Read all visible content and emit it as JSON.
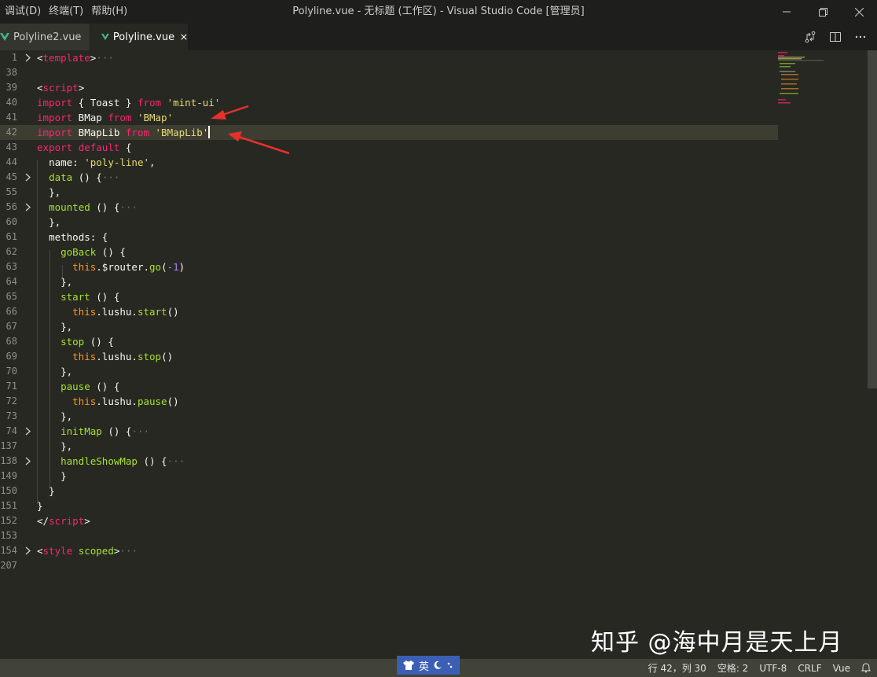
{
  "menu": [
    "调试(D)",
    "终端(T)",
    "帮助(H)"
  ],
  "window_title": "Polyline.vue - 无标题 (工作区) - Visual Studio Code [管理员]",
  "tabs": [
    {
      "label": "Polyline2.vue",
      "active": false
    },
    {
      "label": "Polyline.vue",
      "active": true
    }
  ],
  "lines": [
    {
      "n": "1",
      "fold": true
    },
    {
      "n": "38"
    },
    {
      "n": "39"
    },
    {
      "n": "40"
    },
    {
      "n": "41"
    },
    {
      "n": "42"
    },
    {
      "n": "43"
    },
    {
      "n": "44"
    },
    {
      "n": "45",
      "fold": true
    },
    {
      "n": "55"
    },
    {
      "n": "56",
      "fold": true
    },
    {
      "n": "60"
    },
    {
      "n": "61"
    },
    {
      "n": "62"
    },
    {
      "n": "63"
    },
    {
      "n": "64"
    },
    {
      "n": "65"
    },
    {
      "n": "66"
    },
    {
      "n": "67"
    },
    {
      "n": "68"
    },
    {
      "n": "69"
    },
    {
      "n": "70"
    },
    {
      "n": "71"
    },
    {
      "n": "72"
    },
    {
      "n": "73"
    },
    {
      "n": "74",
      "fold": true
    },
    {
      "n": "137"
    },
    {
      "n": "138",
      "fold": true
    },
    {
      "n": "149"
    },
    {
      "n": "150"
    },
    {
      "n": "151"
    },
    {
      "n": "152"
    },
    {
      "n": "153"
    },
    {
      "n": "154",
      "fold": true
    },
    {
      "n": "207"
    }
  ],
  "code": {
    "l1": {
      "open": "<",
      "tag": "template",
      "close": ">",
      "ell": "···"
    },
    "l39": {
      "open": "<",
      "tag": "script",
      "close": ">"
    },
    "l40": {
      "kw": "import",
      "mid": " { Toast } ",
      "kw2": "from",
      "str": "'mint-ui'"
    },
    "l41": {
      "kw": "import",
      "mid": " BMap ",
      "kw2": "from",
      "str": "'BMap'"
    },
    "l42": {
      "kw": "import",
      "mid": " BMapLib ",
      "kw2": "from",
      "str": "'BMapLib'"
    },
    "l43": {
      "kw": "export",
      "mid": " ",
      "kw2": "default",
      "rest": " {"
    },
    "l44": {
      "key": "name: ",
      "str": "'poly-line'",
      "rest": ","
    },
    "l45": {
      "fn": "data",
      "rest": " () {",
      "ell": "···"
    },
    "l55": "},",
    "l56": {
      "fn": "mounted",
      "rest": " () {",
      "ell": "···"
    },
    "l60": "},",
    "l61": "methods: {",
    "l62": {
      "fn": "goBack",
      "rest": " () {"
    },
    "l63": {
      "this": "this",
      "mid": ".$router.",
      "fn": "go",
      "p1": "(",
      "num": "-1",
      "p2": ")"
    },
    "l64": "},",
    "l65": {
      "fn": "start",
      "rest": " () {"
    },
    "l66": {
      "this": "this",
      "mid": ".lushu.",
      "fn": "start",
      "p": "()"
    },
    "l67": "},",
    "l68": {
      "fn": "stop",
      "rest": " () {"
    },
    "l69": {
      "this": "this",
      "mid": ".lushu.",
      "fn": "stop",
      "p": "()"
    },
    "l70": "},",
    "l71": {
      "fn": "pause",
      "rest": " () {"
    },
    "l72": {
      "this": "this",
      "mid": ".lushu.",
      "fn": "pause",
      "p": "()"
    },
    "l73": "},",
    "l74": {
      "fn": "initMap",
      "rest": " () {",
      "ell": "···"
    },
    "l137": "},",
    "l138": {
      "fn": "handleShowMap",
      "rest": " () {",
      "ell": "···"
    },
    "l149": "}",
    "l150": "}",
    "l151": "}",
    "l152": {
      "open": "</",
      "tag": "script",
      "close": ">"
    },
    "l154": {
      "open": "<",
      "tag": "style",
      "attr": " scoped",
      "close": ">",
      "ell": "···"
    }
  },
  "watermark": "知乎 @海中月是天上月",
  "ime": {
    "label": "英"
  },
  "status": {
    "position": "行 42，列 30",
    "spaces": "空格: 2",
    "encoding": "UTF-8",
    "eol": "CRLF",
    "language": "Vue"
  },
  "colors": {
    "accent": "#3b5fb4",
    "arrow": "#e8302a",
    "vue": "#41b883"
  }
}
